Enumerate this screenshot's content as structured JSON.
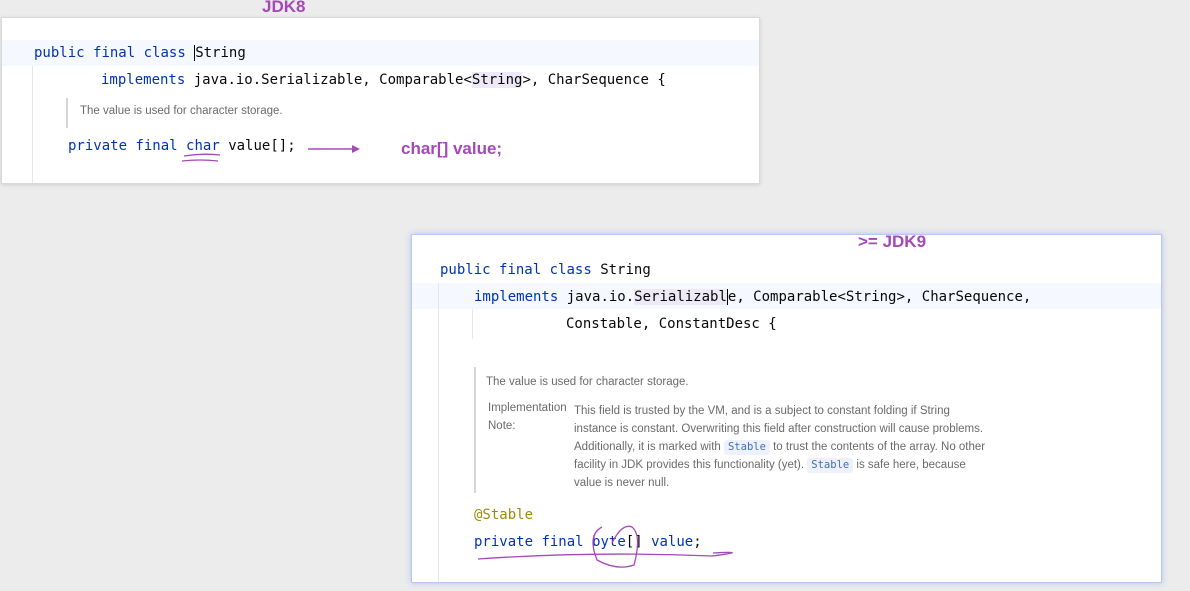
{
  "jdk8": {
    "label": "JDK8",
    "line1": {
      "kw1": "public",
      "kw2": "final",
      "kw3": "class",
      "name": "String"
    },
    "line2": {
      "kw": "implements",
      "rest_a": "java.io.Serializable, ",
      "rest_b": "Comparable<",
      "rest_c": "String",
      "rest_d": ">, CharSequence {"
    },
    "doc": "The value is used for character storage.",
    "field": {
      "kw1": "private",
      "kw2": "final",
      "type": "char",
      "rest": "value[];"
    },
    "annotation": "char[] value;"
  },
  "jdk9": {
    "label": ">= JDK9",
    "line1": {
      "kw1": "public",
      "kw2": "final",
      "kw3": "class",
      "name": "String"
    },
    "line2": {
      "kw": "implements",
      "rest_a": "java.io.",
      "rest_b": "Serializabl",
      "rest_c": "e",
      "rest_d": ", Comparable<String>, CharSequence,"
    },
    "line3": "Constable, ConstantDesc {",
    "doc_summary": "The value is used for character storage.",
    "impl_label_1": "Implementation",
    "impl_label_2": "Note:",
    "impl_lines": {
      "l1": "This field is trusted by the VM, and is a subject to constant folding if String",
      "l2": "instance is constant. Overwriting this field after construction will cause problems.",
      "l3a": "Additionally, it is marked with ",
      "chip1": "Stable",
      "l3b": " to trust the contents of the array. No other",
      "l4a": "facility in JDK provides this functionality (yet). ",
      "chip2": "Stable",
      "l4b": " is safe here, because",
      "l5": "value is never null."
    },
    "annotation": "@Stable",
    "field": {
      "kw1": "private",
      "kw2": "final",
      "type": "byte",
      "brackets": "[]",
      "name": "value",
      "semi": ";"
    }
  },
  "colors": {
    "purple_ink": "#a548b8",
    "keyword": "#0033b3",
    "annotation": "#9e880d"
  }
}
